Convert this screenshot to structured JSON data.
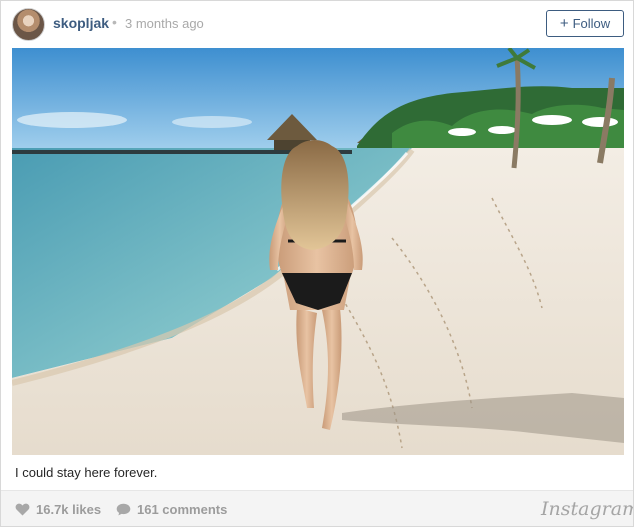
{
  "header": {
    "username": "skopljak",
    "separator": "•",
    "timestamp": "3 months ago",
    "follow_label": "Follow",
    "follow_icon": "+"
  },
  "post": {
    "image_subject": "beach-photo",
    "caption": "I could stay here forever."
  },
  "footer": {
    "likes": "16.7k likes",
    "comments": "161 comments",
    "brand": "Instagram"
  },
  "colors": {
    "username": "#3d5c80",
    "follow_border": "#3d5c80",
    "meta_gray": "#9c9c9c",
    "footer_bg": "#f4f4f4"
  }
}
